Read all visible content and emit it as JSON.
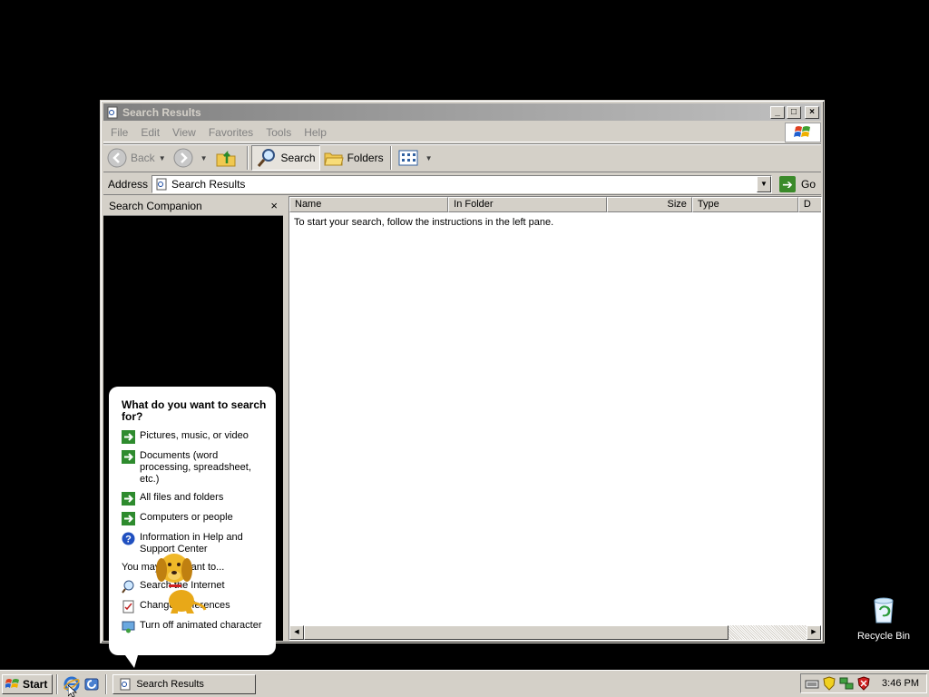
{
  "window": {
    "title": "Search Results",
    "controls": {
      "minimize": "_",
      "maximize": "□",
      "close": "×"
    }
  },
  "menu": [
    "File",
    "Edit",
    "View",
    "Favorites",
    "Tools",
    "Help"
  ],
  "toolbar": {
    "back_label": "Back",
    "search_label": "Search",
    "folders_label": "Folders"
  },
  "address": {
    "label": "Address",
    "value": "Search Results",
    "go_label": "Go"
  },
  "search_companion": {
    "title": "Search Companion",
    "close": "×",
    "question": "What do you want to search for?",
    "options": [
      {
        "label": "Pictures, music, or video",
        "icon": "green-arrow-icon"
      },
      {
        "label": "Documents (word processing, spreadsheet, etc.)",
        "icon": "green-arrow-icon"
      },
      {
        "label": "All files and folders",
        "icon": "green-arrow-icon"
      },
      {
        "label": "Computers or people",
        "icon": "green-arrow-icon"
      },
      {
        "label": "Information in Help and Support Center",
        "icon": "help-icon"
      }
    ],
    "also_label": "You may also want to...",
    "also": [
      {
        "label": "Search the Internet",
        "icon": "internet-search-icon"
      },
      {
        "label": "Change preferences",
        "icon": "preferences-icon"
      },
      {
        "label": "Turn off animated character",
        "icon": "character-icon"
      }
    ]
  },
  "results": {
    "columns": [
      "Name",
      "In Folder",
      "Size",
      "Type",
      "D"
    ],
    "empty_message": "To start your search, follow the instructions in the left pane."
  },
  "desktop": {
    "recycle_bin_label": "Recycle Bin"
  },
  "taskbar": {
    "start_label": "Start",
    "task_label": "Search Results",
    "clock": "3:46 PM"
  },
  "colors": {
    "desktop": "#000000",
    "chrome": "#d4d0c8",
    "titlebar_inactive": "#808080"
  }
}
